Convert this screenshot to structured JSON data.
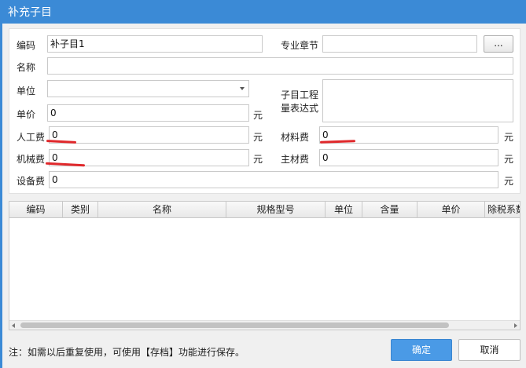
{
  "window": {
    "title": "补充子目"
  },
  "form": {
    "code_label": "编码",
    "code_value": "补子目1",
    "chapter_label": "专业章节",
    "chapter_value": "",
    "chapter_browse": "...",
    "name_label": "名称",
    "name_value": "",
    "unit_label": "单位",
    "unit_value": "",
    "quantity_expr_label_line1": "子目工程",
    "quantity_expr_label_line2": "量表达式",
    "quantity_expr_value": "",
    "price_label": "单价",
    "price_value": "0",
    "labor_label": "人工费",
    "labor_value": "0",
    "material_label": "材料费",
    "material_value": "0",
    "machine_label": "机械费",
    "machine_value": "0",
    "main_material_label": "主材费",
    "main_material_value": "0",
    "equipment_label": "设备费",
    "equipment_value": "0",
    "currency_unit": "元"
  },
  "grid": {
    "columns": [
      "编码",
      "类别",
      "名称",
      "规格型号",
      "单位",
      "含量",
      "单价",
      "除税系数"
    ],
    "rows": []
  },
  "footer": {
    "note": "注：如需以后重复使用，可使用【存档】功能进行保存。",
    "ok_label": "确定",
    "cancel_label": "取消"
  },
  "colors": {
    "title_bar": "#3b8ad6",
    "primary_button": "#4a9ae6",
    "annotation": "#e0282b"
  }
}
